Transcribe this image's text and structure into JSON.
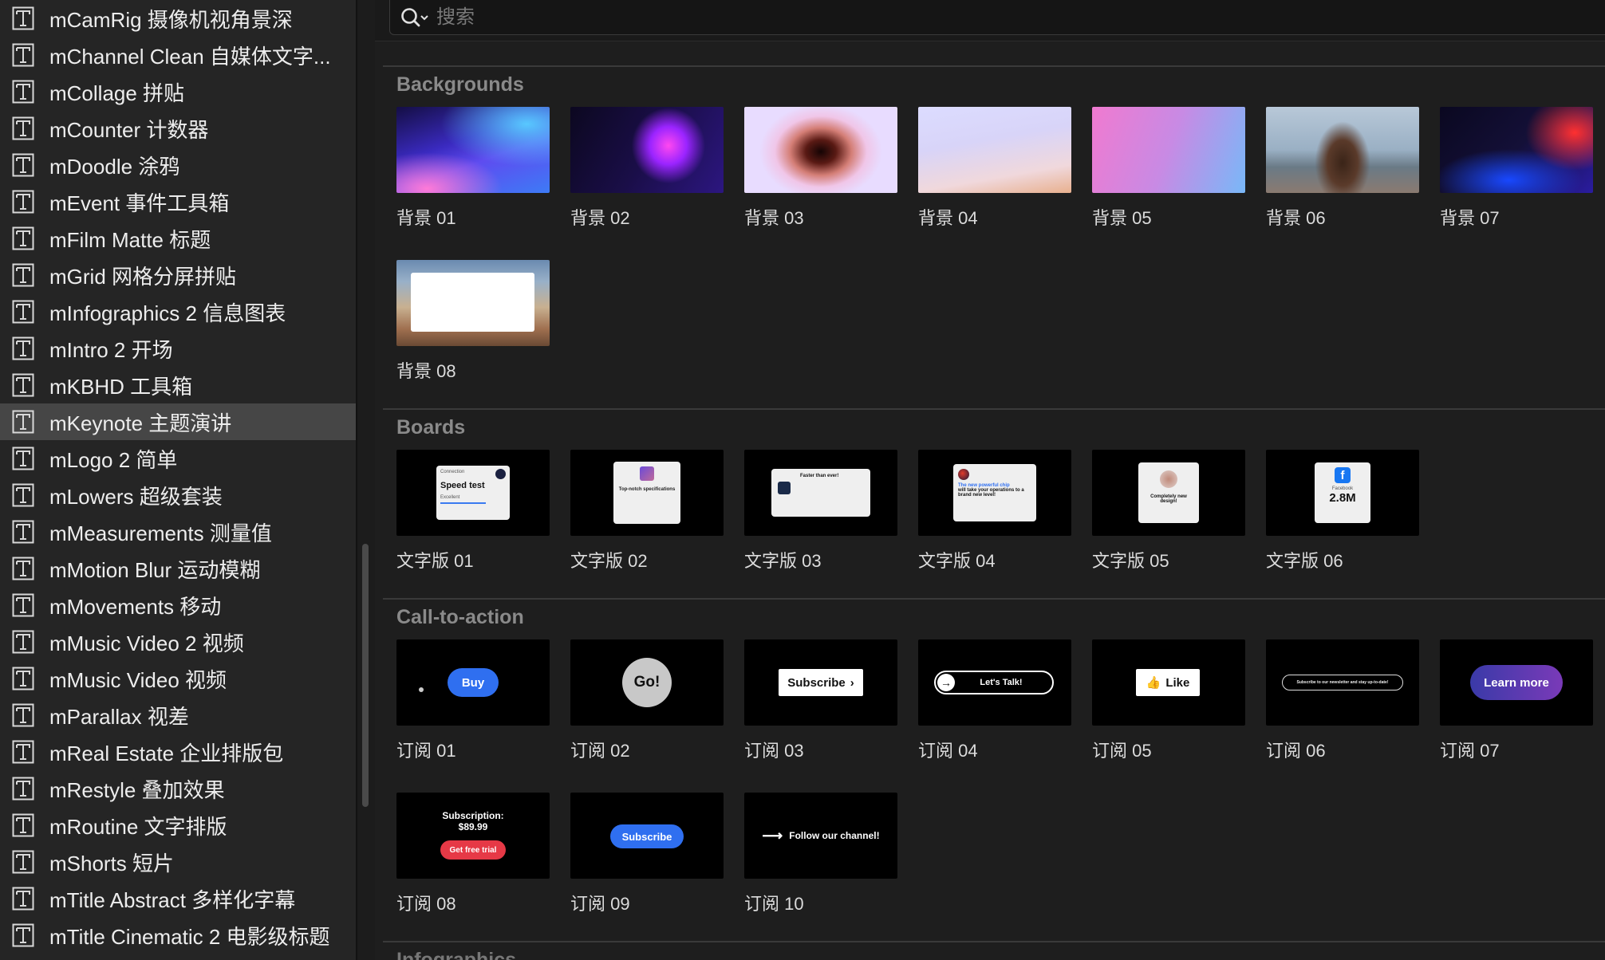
{
  "sidebar": {
    "items": [
      {
        "label": "mCamRig 摄像机视角景深",
        "selected": false
      },
      {
        "label": "mChannel Clean 自媒体文字...",
        "selected": false
      },
      {
        "label": "mCollage 拼贴",
        "selected": false
      },
      {
        "label": "mCounter 计数器",
        "selected": false
      },
      {
        "label": "mDoodle 涂鸦",
        "selected": false
      },
      {
        "label": "mEvent 事件工具箱",
        "selected": false
      },
      {
        "label": "mFilm Matte 标题",
        "selected": false
      },
      {
        "label": "mGrid 网格分屏拼贴",
        "selected": false
      },
      {
        "label": "mInfographics 2 信息图表",
        "selected": false
      },
      {
        "label": "mIntro 2 开场",
        "selected": false
      },
      {
        "label": "mKBHD 工具箱",
        "selected": false
      },
      {
        "label": "mKeynote 主题演讲",
        "selected": true
      },
      {
        "label": "mLogo 2 简单",
        "selected": false
      },
      {
        "label": "mLowers 超级套装",
        "selected": false
      },
      {
        "label": "mMeasurements 测量值",
        "selected": false
      },
      {
        "label": "mMotion Blur 运动模糊",
        "selected": false
      },
      {
        "label": "mMovements 移动",
        "selected": false
      },
      {
        "label": "mMusic Video 2 视频",
        "selected": false
      },
      {
        "label": "mMusic Video 视频",
        "selected": false
      },
      {
        "label": "mParallax 视差",
        "selected": false
      },
      {
        "label": "mReal Estate 企业排版包",
        "selected": false
      },
      {
        "label": "mRestyle 叠加效果",
        "selected": false
      },
      {
        "label": "mRoutine 文字排版",
        "selected": false
      },
      {
        "label": "mShorts 短片",
        "selected": false
      },
      {
        "label": "mTitle Abstract 多样化字幕",
        "selected": false
      },
      {
        "label": "mTitle Cinematic 2 电影级标题",
        "selected": false
      }
    ],
    "item_icon": "text-title-icon"
  },
  "search": {
    "placeholder": "搜索",
    "value": ""
  },
  "sections": {
    "backgrounds": {
      "title": "Backgrounds",
      "items": [
        "背景 01",
        "背景 02",
        "背景 03",
        "背景 04",
        "背景 05",
        "背景 06",
        "背景 07",
        "背景 08"
      ]
    },
    "boards": {
      "title": "Boards",
      "items": [
        "文字版 01",
        "文字版 02",
        "文字版 03",
        "文字版 04",
        "文字版 05",
        "文字版 06"
      ],
      "thumbs": {
        "b1": {
          "heading": "Connection",
          "title": "Speed test",
          "sub": "Excellent"
        },
        "b2": {
          "title": "Top-notch specifications"
        },
        "b3": {
          "title": "Faster than ever!"
        },
        "b4": {
          "title_colored": "The new powerful chip",
          "title": "will take your operations to a brand new level!"
        },
        "b5": {
          "title": "Completely new design!"
        },
        "b6": {
          "heading": "Facebook",
          "value": "2.8M"
        }
      }
    },
    "cta": {
      "title": "Call-to-action",
      "items": [
        "订阅 01",
        "订阅 02",
        "订阅 03",
        "订阅 04",
        "订阅 05",
        "订阅 06",
        "订阅 07",
        "订阅 08",
        "订阅 09",
        "订阅 10"
      ],
      "thumbs": {
        "c1": "Buy",
        "c2": "Go!",
        "c3": "Subscribe",
        "c4": "Let's Talk!",
        "c5": "Like",
        "c6": "Subscribe to our newsletter and stay up-to-date!",
        "c7": "Learn more",
        "c8_title": "Subscription:",
        "c8_price": "$89.99",
        "c8_button": "Get free trial",
        "c9": "Subscribe",
        "c10": "Follow our channel!"
      }
    },
    "infographics": {
      "title": "Infographics"
    }
  },
  "colors": {
    "accent_blue": "#2f6ff0",
    "cta_red": "#e63946",
    "selected_row": "#464646",
    "section_title": "#8a8a8a"
  }
}
